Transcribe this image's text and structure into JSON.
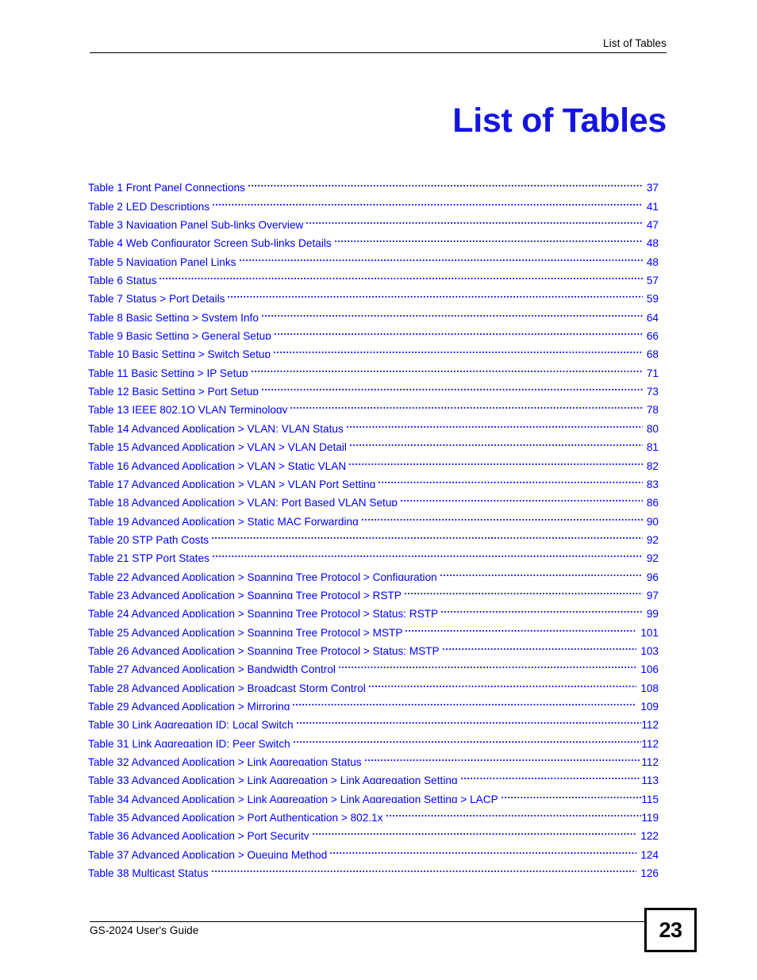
{
  "header": {
    "running_head": "List of Tables"
  },
  "title": "List of Tables",
  "toc": {
    "entries": [
      {
        "label": "Table 1 Front Panel Connections",
        "page": "37"
      },
      {
        "label": "Table 2 LED Descriptions",
        "page": "41"
      },
      {
        "label": "Table 3 Navigation Panel Sub-links Overview",
        "page": "47"
      },
      {
        "label": "Table 4 Web Configurator Screen Sub-links Details",
        "page": "48"
      },
      {
        "label": "Table 5 Navigation Panel Links",
        "page": "48"
      },
      {
        "label": "Table 6 Status",
        "page": "57"
      },
      {
        "label": "Table 7 Status > Port Details",
        "page": "59"
      },
      {
        "label": "Table 8 Basic Setting > System Info",
        "page": "64"
      },
      {
        "label": "Table 9 Basic Setting > General Setup",
        "page": "66"
      },
      {
        "label": "Table 10 Basic Setting > Switch Setup",
        "page": "68"
      },
      {
        "label": "Table 11 Basic Setting > IP Setup",
        "page": "71"
      },
      {
        "label": "Table 12 Basic Setting > Port Setup",
        "page": "73"
      },
      {
        "label": "Table 13 IEEE 802.1Q VLAN Terminology",
        "page": "78"
      },
      {
        "label": "Table 14 Advanced Application > VLAN: VLAN Status",
        "page": "80"
      },
      {
        "label": "Table 15 Advanced Application > VLAN > VLAN Detail",
        "page": "81"
      },
      {
        "label": "Table 16 Advanced Application > VLAN > Static VLAN",
        "page": "82"
      },
      {
        "label": "Table 17 Advanced Application > VLAN > VLAN Port Setting",
        "page": "83"
      },
      {
        "label": "Table 18 Advanced Application > VLAN: Port Based VLAN Setup",
        "page": "86"
      },
      {
        "label": "Table 19 Advanced Application > Static MAC Forwarding",
        "page": "90"
      },
      {
        "label": "Table 20 STP Path Costs",
        "page": "92"
      },
      {
        "label": "Table 21 STP Port States",
        "page": "92"
      },
      {
        "label": "Table 22 Advanced Application > Spanning Tree Protocol > Configuration",
        "page": "96"
      },
      {
        "label": "Table 23 Advanced Application > Spanning Tree Protocol > RSTP",
        "page": "97"
      },
      {
        "label": "Table 24 Advanced Application > Spanning Tree Protocol > Status: RSTP",
        "page": "99"
      },
      {
        "label": "Table 25 Advanced Application > Spanning Tree Protocol > MSTP",
        "page": "101"
      },
      {
        "label": "Table 26 Advanced Application > Spanning Tree Protocol > Status: MSTP",
        "page": "103"
      },
      {
        "label": "Table 27 Advanced Application > Bandwidth Control",
        "page": "106"
      },
      {
        "label": "Table 28 Advanced Application > Broadcast Storm Control",
        "page": "108"
      },
      {
        "label": "Table 29 Advanced Application > Mirroring",
        "page": "109"
      },
      {
        "label": "Table 30 Link Aggregation ID: Local Switch",
        "page": "112",
        "tight": true
      },
      {
        "label": "Table 31 Link Aggregation ID: Peer Switch",
        "page": "112",
        "tight": true
      },
      {
        "label": "Table 32 Advanced Application > Link Aggregation Status",
        "page": "112",
        "tight": true
      },
      {
        "label": "Table 33 Advanced Application > Link Aggregation > Link Aggregation Setting",
        "page": "113",
        "tight": true
      },
      {
        "label": "Table 34 Advanced Application > Link Aggregation > Link Aggregation Setting > LACP",
        "page": "115",
        "tight": true
      },
      {
        "label": "Table 35 Advanced Application > Port Authentication > 802.1x",
        "page": "119",
        "tight": true
      },
      {
        "label": "Table 36 Advanced Application > Port Security",
        "page": "122"
      },
      {
        "label": "Table 37 Advanced Application > Queuing Method",
        "page": "124"
      },
      {
        "label": "Table 38 Multicast Status",
        "page": "126"
      }
    ]
  },
  "footer": {
    "guide_text": "GS-2024 User's Guide",
    "page_number": "23"
  },
  "colors": {
    "link_blue": "#0000ff",
    "title_blue": "#1414e0",
    "rule_black": "#000000"
  }
}
